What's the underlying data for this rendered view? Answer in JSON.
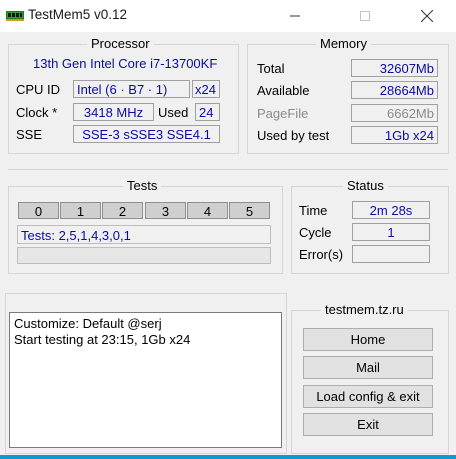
{
  "window": {
    "title": "TestMem5 v0.12"
  },
  "processor": {
    "title": "Processor",
    "cpu_name": "13th Gen Intel Core i7-13700KF",
    "cpu_id_label": "CPU ID",
    "cpu_id_value": "Intel  (6 · B7 · 1)",
    "threads_value": "x24",
    "clock_label": "Clock *",
    "clock_value": "3418 MHz",
    "used_label": "Used",
    "used_value": "24",
    "sse_label": "SSE",
    "sse_value": "SSE-3 sSSE3 SSE4.1"
  },
  "memory": {
    "title": "Memory",
    "total_label": "Total",
    "total_value": "32607Mb",
    "available_label": "Available",
    "available_value": "28664Mb",
    "pagefile_label": "PageFile",
    "pagefile_value": "6662Mb",
    "used_by_test_label": "Used by test",
    "used_by_test_value": "1Gb x24"
  },
  "tests": {
    "title": "Tests",
    "cells": [
      "0",
      "1",
      "2",
      "3",
      "4",
      "5"
    ],
    "sequence_text": "Tests: 2,5,1,4,3,0,1",
    "progress": ""
  },
  "status": {
    "title": "Status",
    "time_label": "Time",
    "time_value": "2m 28s",
    "cycle_label": "Cycle",
    "cycle_value": "1",
    "errors_label": "Error(s)",
    "errors_value": ""
  },
  "log": {
    "lines": [
      "Customize: Default @serj",
      "Start testing at 23:15, 1Gb x24"
    ]
  },
  "site": {
    "title": "testmem.tz.ru",
    "home_label": "Home",
    "mail_label": "Mail",
    "load_label": "Load config & exit",
    "exit_label": "Exit"
  },
  "colors": {
    "value_text": "#0b0ba5",
    "accent_strip": "#0a9bd1"
  }
}
